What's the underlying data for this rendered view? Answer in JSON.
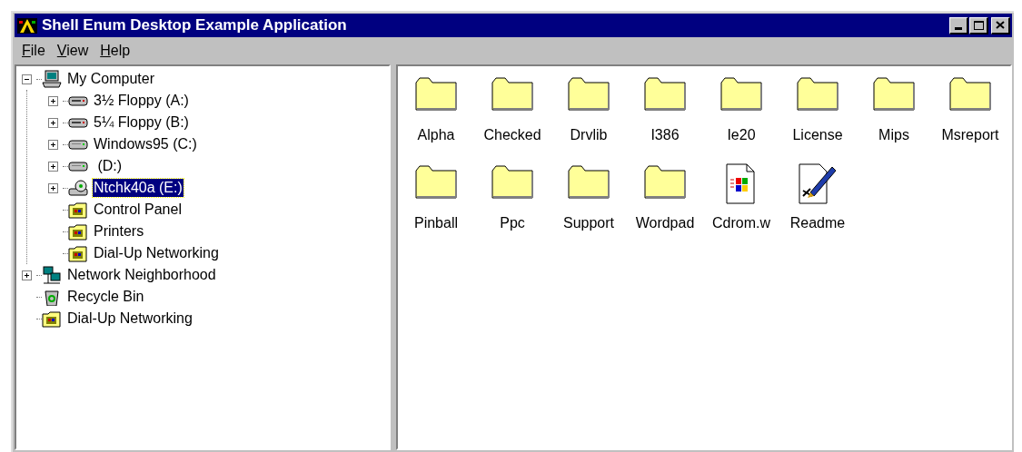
{
  "window": {
    "title": "Shell Enum Desktop Example Application"
  },
  "menu": [
    {
      "label": "File"
    },
    {
      "label": "View"
    },
    {
      "label": "Help"
    }
  ],
  "tree": [
    {
      "label": "My Computer",
      "kind": "computer",
      "expanded": true,
      "selected": false,
      "children": [
        {
          "label": "3½ Floppy (A:)",
          "kind": "floppy",
          "expanded": false,
          "selected": false
        },
        {
          "label": "5¼ Floppy (B:)",
          "kind": "floppy",
          "expanded": false,
          "selected": false
        },
        {
          "label": "Windows95 (C:)",
          "kind": "drive",
          "expanded": false,
          "selected": false
        },
        {
          "label": " (D:)",
          "kind": "drive",
          "expanded": false,
          "selected": false
        },
        {
          "label": "Ntchk40a (E:)",
          "kind": "cdrom",
          "expanded": false,
          "selected": true
        },
        {
          "label": "Control Panel",
          "kind": "special-folder",
          "selected": false
        },
        {
          "label": "Printers",
          "kind": "special-folder",
          "selected": false
        },
        {
          "label": "Dial-Up Networking",
          "kind": "special-folder",
          "selected": false
        }
      ]
    },
    {
      "label": "Network Neighborhood",
      "kind": "network",
      "expanded": false,
      "selected": false
    },
    {
      "label": "Recycle Bin",
      "kind": "recycle",
      "selected": false
    },
    {
      "label": "Dial-Up Networking",
      "kind": "special-folder",
      "selected": false
    }
  ],
  "files": [
    {
      "label": "Alpha",
      "kind": "folder"
    },
    {
      "label": "Checked",
      "kind": "folder"
    },
    {
      "label": "Drvlib",
      "kind": "folder"
    },
    {
      "label": "I386",
      "kind": "folder"
    },
    {
      "label": "Ie20",
      "kind": "folder"
    },
    {
      "label": "License",
      "kind": "folder"
    },
    {
      "label": "Mips",
      "kind": "folder"
    },
    {
      "label": "Msreport",
      "kind": "folder"
    },
    {
      "label": "Pinball",
      "kind": "folder"
    },
    {
      "label": "Ppc",
      "kind": "folder"
    },
    {
      "label": "Support",
      "kind": "folder"
    },
    {
      "label": "Wordpad",
      "kind": "folder"
    },
    {
      "label": "Cdrom.w",
      "kind": "setup-document"
    },
    {
      "label": "Readme",
      "kind": "pen-document"
    }
  ]
}
